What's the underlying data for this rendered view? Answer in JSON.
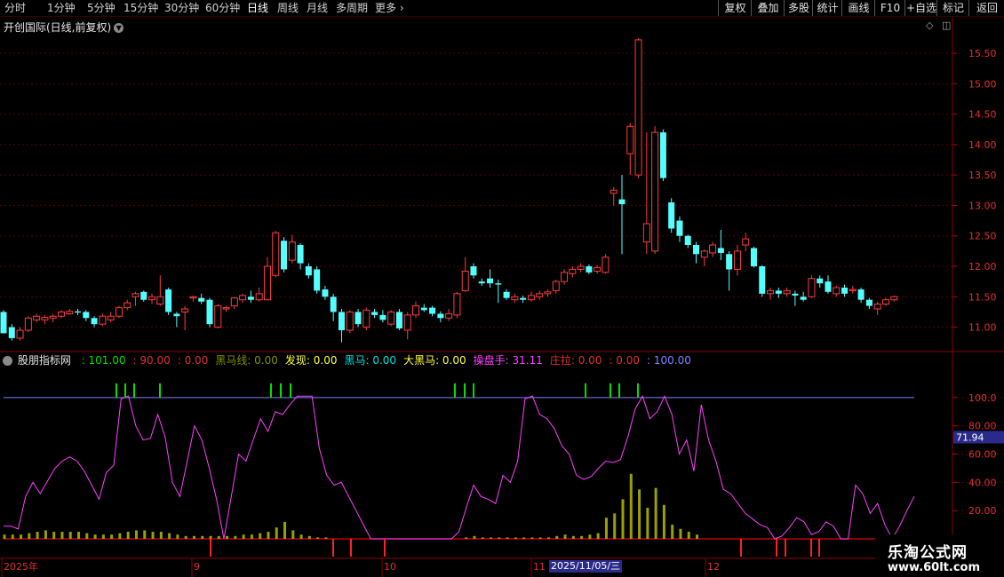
{
  "toolbar": {
    "periods": [
      "分时",
      "1分钟",
      "5分钟",
      "15分钟",
      "30分钟",
      "60分钟",
      "日线",
      "周线",
      "月线",
      "多周期",
      "更多"
    ],
    "active": "日线",
    "right_buttons": [
      "复权",
      "叠加",
      "多股",
      "统计",
      "画线",
      "F10",
      "+自选",
      "标记",
      "返回"
    ]
  },
  "chart_title": "开创国际(日线,前复权)",
  "price_axis": {
    "ticks": [
      "15.50",
      "15.00",
      "14.50",
      "14.00",
      "13.50",
      "13.00",
      "12.50",
      "12.00",
      "11.50",
      "11.00"
    ]
  },
  "indicator": {
    "name": "股朋指标网",
    "values": [
      {
        "text": ": 101.00",
        "color": "#00e000"
      },
      {
        "text": ": 90.00",
        "color": "#e03030"
      },
      {
        "text": ": 0.00",
        "color": "#e03030"
      },
      {
        "text": "黑马线: 0.00",
        "color": "#809000"
      },
      {
        "text": "发现: 0.00",
        "color": "#ffff40"
      },
      {
        "text": "黑马: 0.00",
        "color": "#00e0e0"
      },
      {
        "text": "大黑马: 0.00",
        "color": "#ffff40"
      },
      {
        "text": "操盘手: 31.11",
        "color": "#ff40ff"
      },
      {
        "text": "庄拉: 0.00",
        "color": "#e03030"
      },
      {
        "text": ": 0.00",
        "color": "#e03030"
      },
      {
        "text": ": 100.00",
        "color": "#8080ff"
      }
    ],
    "axis_ticks": [
      "100.0",
      "80.00",
      "60.00",
      "40.00",
      "20.00"
    ],
    "current_value": "71.94"
  },
  "date_axis": {
    "labels": [
      "2025年",
      "9",
      "10",
      "11",
      "12"
    ],
    "highlight": "2025/11/05/三"
  },
  "watermark": {
    "line1": "乐淘公式网",
    "line2": "www.60lt.com"
  },
  "colors": {
    "up": "#ff3c3c",
    "down": "#54ffff",
    "line": "#ff40ff",
    "signal": "#00e000",
    "bar": "#9aa000",
    "zero_line": "#c00000"
  },
  "chart_data": {
    "type": "candlestick",
    "title": "开创国际(日线,前复权)",
    "ylim": [
      10.6,
      15.85
    ],
    "candles": [
      [
        11.25,
        10.9,
        11.28,
        10.9
      ],
      [
        11.0,
        10.82,
        11.05,
        10.78
      ],
      [
        10.82,
        10.95,
        11.0,
        10.78
      ],
      [
        10.95,
        11.15,
        11.18,
        10.92
      ],
      [
        11.12,
        11.18,
        11.22,
        11.08
      ],
      [
        11.12,
        11.16,
        11.2,
        11.05
      ],
      [
        11.15,
        11.18,
        11.22,
        11.08
      ],
      [
        11.18,
        11.25,
        11.28,
        11.15
      ],
      [
        11.22,
        11.26,
        11.3,
        11.2
      ],
      [
        11.26,
        11.24,
        11.3,
        11.2
      ],
      [
        11.25,
        11.15,
        11.28,
        11.1
      ],
      [
        11.15,
        11.05,
        11.18,
        11.0
      ],
      [
        11.05,
        11.18,
        11.22,
        11.02
      ],
      [
        11.12,
        11.18,
        11.25,
        11.08
      ],
      [
        11.18,
        11.32,
        11.35,
        11.15
      ],
      [
        11.32,
        11.4,
        11.45,
        11.28
      ],
      [
        11.5,
        11.55,
        11.58,
        11.35
      ],
      [
        11.58,
        11.45,
        11.6,
        11.42
      ],
      [
        11.45,
        11.5,
        11.55,
        11.38
      ],
      [
        11.38,
        11.5,
        11.85,
        11.35
      ],
      [
        11.62,
        11.25,
        11.65,
        11.2
      ],
      [
        11.22,
        11.18,
        11.25,
        11.0
      ],
      [
        11.25,
        11.3,
        11.35,
        10.95
      ],
      [
        11.48,
        11.5,
        11.52,
        11.42
      ],
      [
        11.48,
        11.42,
        11.55,
        11.38
      ],
      [
        11.45,
        11.05,
        11.48,
        11.0
      ],
      [
        11.0,
        11.35,
        11.38,
        10.98
      ],
      [
        11.3,
        11.32,
        11.35,
        11.25
      ],
      [
        11.35,
        11.48,
        11.5,
        11.3
      ],
      [
        11.45,
        11.52,
        11.55,
        11.4
      ],
      [
        11.5,
        11.45,
        11.6,
        11.4
      ],
      [
        11.45,
        11.55,
        11.65,
        11.42
      ],
      [
        11.45,
        12.0,
        12.15,
        11.45
      ],
      [
        11.85,
        12.55,
        12.58,
        11.82
      ],
      [
        12.42,
        11.95,
        12.48,
        11.9
      ],
      [
        12.1,
        12.4,
        12.52,
        12.05
      ],
      [
        12.35,
        12.05,
        12.38,
        11.95
      ],
      [
        12.0,
        11.85,
        12.05,
        11.8
      ],
      [
        11.95,
        11.6,
        12.0,
        11.55
      ],
      [
        11.62,
        11.5,
        11.68,
        11.45
      ],
      [
        11.5,
        11.25,
        11.55,
        11.1
      ],
      [
        11.25,
        10.95,
        11.3,
        10.75
      ],
      [
        10.95,
        11.25,
        11.28,
        10.9
      ],
      [
        11.25,
        11.05,
        11.3,
        11.0
      ],
      [
        11.0,
        11.28,
        11.32,
        10.95
      ],
      [
        11.25,
        11.2,
        11.3,
        11.15
      ],
      [
        11.2,
        11.12,
        11.28,
        11.08
      ],
      [
        11.05,
        11.25,
        11.28,
        11.02
      ],
      [
        11.25,
        10.98,
        11.3,
        10.95
      ],
      [
        10.95,
        11.2,
        11.25,
        10.8
      ],
      [
        11.2,
        11.35,
        11.42,
        11.15
      ],
      [
        11.32,
        11.28,
        11.38,
        11.25
      ],
      [
        11.32,
        11.22,
        11.35,
        11.18
      ],
      [
        11.22,
        11.15,
        11.26,
        11.08
      ],
      [
        11.15,
        11.22,
        11.3,
        11.1
      ],
      [
        11.2,
        11.55,
        11.58,
        11.15
      ],
      [
        11.6,
        11.92,
        12.15,
        11.58
      ],
      [
        12.0,
        11.85,
        12.05,
        11.8
      ],
      [
        11.75,
        11.72,
        11.8,
        11.68
      ],
      [
        11.8,
        11.72,
        11.95,
        11.65
      ],
      [
        11.72,
        11.7,
        11.78,
        11.4
      ],
      [
        11.58,
        11.48,
        11.62,
        11.45
      ],
      [
        11.45,
        11.5,
        11.55,
        11.4
      ],
      [
        11.48,
        11.45,
        11.52,
        11.4
      ],
      [
        11.45,
        11.52,
        11.58,
        11.42
      ],
      [
        11.5,
        11.55,
        11.6,
        11.45
      ],
      [
        11.55,
        11.58,
        11.62,
        11.5
      ],
      [
        11.6,
        11.75,
        11.78,
        11.55
      ],
      [
        11.75,
        11.9,
        11.95,
        11.7
      ],
      [
        11.88,
        11.95,
        12.0,
        11.82
      ],
      [
        11.95,
        12.0,
        12.05,
        11.9
      ],
      [
        12.0,
        11.9,
        12.03,
        11.87
      ],
      [
        11.92,
        11.98,
        12.02,
        11.88
      ],
      [
        11.9,
        12.15,
        12.2,
        11.88
      ],
      [
        13.2,
        13.25,
        13.3,
        13.0
      ],
      [
        13.1,
        13.02,
        13.5,
        12.2
      ],
      [
        13.85,
        14.3,
        14.35,
        13.5
      ],
      [
        13.5,
        15.72,
        15.75,
        13.45
      ],
      [
        12.4,
        12.7,
        14.2,
        12.2
      ],
      [
        12.25,
        14.2,
        14.3,
        12.2
      ],
      [
        14.2,
        13.45,
        14.25,
        13.4
      ],
      [
        13.05,
        12.62,
        13.12,
        12.55
      ],
      [
        12.75,
        12.5,
        12.82,
        12.4
      ],
      [
        12.5,
        12.35,
        12.52,
        12.3
      ],
      [
        12.35,
        12.2,
        12.4,
        12.05
      ],
      [
        12.15,
        12.25,
        12.28,
        12.0
      ],
      [
        12.22,
        12.35,
        12.4,
        12.15
      ],
      [
        12.3,
        12.22,
        12.6,
        12.1
      ],
      [
        12.2,
        11.95,
        12.25,
        11.6
      ],
      [
        11.95,
        12.25,
        12.35,
        11.85
      ],
      [
        12.35,
        12.45,
        12.55,
        12.25
      ],
      [
        12.3,
        12.0,
        12.32,
        11.98
      ],
      [
        12.0,
        11.55,
        12.02,
        11.5
      ],
      [
        11.55,
        11.6,
        11.65,
        11.45
      ],
      [
        11.6,
        11.55,
        11.65,
        11.48
      ],
      [
        11.55,
        11.6,
        11.65,
        11.5
      ],
      [
        11.55,
        11.52,
        11.6,
        11.35
      ],
      [
        11.5,
        11.45,
        11.58,
        11.42
      ],
      [
        11.5,
        11.8,
        11.85,
        11.48
      ],
      [
        11.8,
        11.72,
        11.85,
        11.65
      ],
      [
        11.75,
        11.58,
        11.85,
        11.55
      ],
      [
        11.55,
        11.65,
        11.68,
        11.5
      ],
      [
        11.65,
        11.55,
        11.7,
        11.5
      ],
      [
        11.6,
        11.62,
        11.68,
        11.55
      ],
      [
        11.62,
        11.45,
        11.65,
        11.4
      ],
      [
        11.45,
        11.35,
        11.48,
        11.3
      ],
      [
        11.3,
        11.38,
        11.42,
        11.2
      ],
      [
        11.38,
        11.45,
        11.48,
        11.35
      ],
      [
        11.45,
        11.5,
        11.52,
        11.42
      ]
    ],
    "osc_line": [
      9,
      9,
      7,
      30,
      40,
      32,
      41,
      50,
      55,
      58,
      55,
      48,
      38,
      28,
      47,
      52,
      99,
      101,
      80,
      70,
      71,
      88,
      72,
      40,
      30,
      55,
      80,
      70,
      50,
      28,
      0,
      30,
      60,
      55,
      70,
      85,
      76,
      90,
      88,
      95,
      101,
      101,
      101,
      64,
      45,
      38,
      40,
      30,
      20,
      10,
      0,
      0,
      0,
      0,
      0,
      0,
      0,
      0,
      0,
      0,
      0,
      0,
      5,
      22,
      38,
      30,
      28,
      25,
      45,
      40,
      55,
      99,
      101,
      88,
      85,
      78,
      66,
      60,
      45,
      42,
      44,
      50,
      55,
      54,
      56,
      72,
      92,
      101,
      85,
      90,
      101,
      88,
      60,
      70,
      48,
      95,
      70,
      55,
      35,
      32,
      25,
      18,
      14,
      10,
      8,
      0,
      2,
      8,
      15,
      12,
      3,
      5,
      12,
      9,
      0,
      0,
      38,
      32,
      18,
      25,
      10,
      0,
      9,
      20,
      30
    ],
    "bars": [
      3,
      3,
      3,
      4,
      5,
      6,
      5,
      5,
      5,
      5,
      4,
      3,
      3,
      3,
      4,
      5,
      6,
      6,
      5,
      5,
      4,
      3,
      2,
      2,
      2,
      2,
      2,
      2,
      2,
      3,
      3,
      4,
      5,
      8,
      12,
      6,
      3,
      2,
      1,
      1,
      0,
      0,
      0,
      0,
      0,
      0,
      0,
      0,
      0,
      0,
      0,
      0,
      0,
      0,
      0,
      0,
      1,
      2,
      1,
      1,
      1,
      1,
      1,
      1,
      1,
      1,
      1,
      2,
      3,
      2,
      2,
      3,
      4,
      15,
      18,
      28,
      46,
      35,
      22,
      36,
      24,
      10,
      7,
      5,
      3,
      0,
      0,
      0,
      0,
      0,
      0,
      0,
      0,
      0,
      0,
      0,
      0,
      0,
      0,
      0,
      0,
      0,
      0,
      0,
      0,
      0,
      0
    ],
    "signal_x": [
      131,
      141,
      151,
      180,
      305,
      316,
      327,
      512,
      523,
      533,
      659,
      687,
      697,
      718
    ],
    "red_x": [
      237,
      375,
      395,
      433,
      834,
      874,
      884,
      913,
      922
    ],
    "ind_ylim": [
      0,
      120
    ],
    "hline": 100
  }
}
